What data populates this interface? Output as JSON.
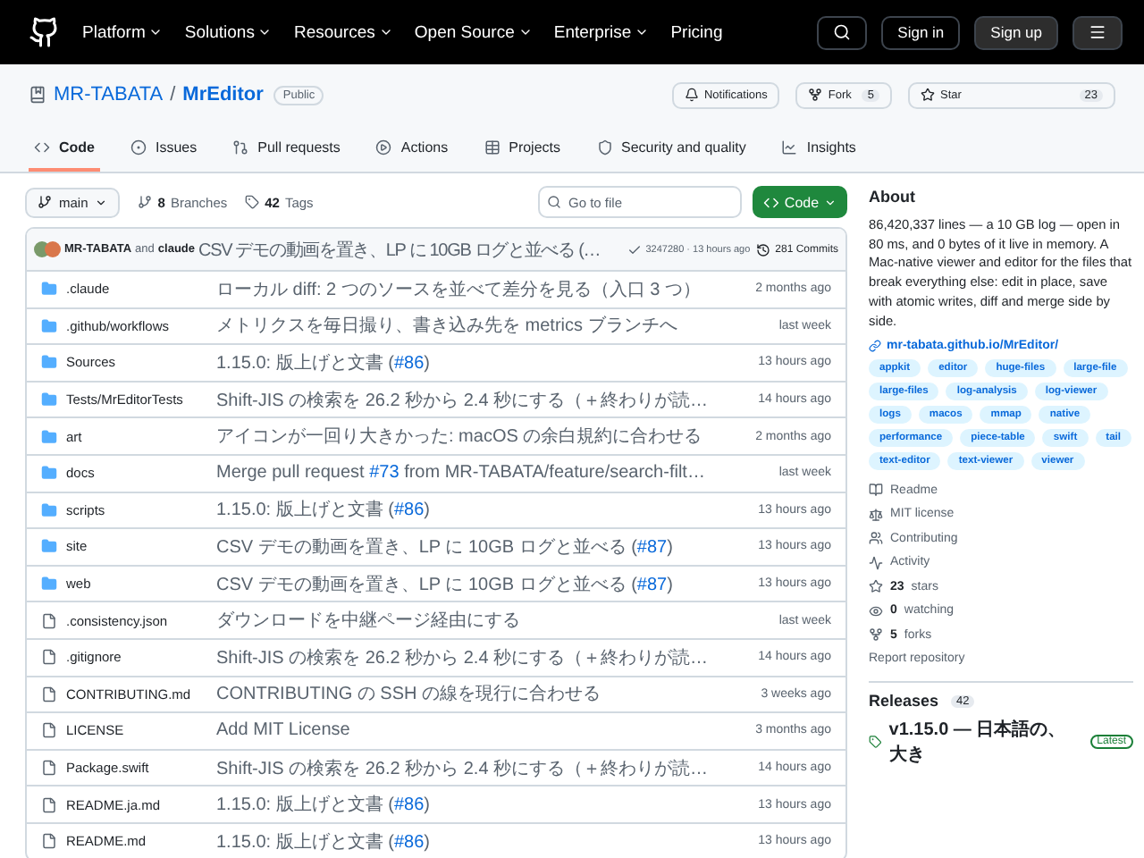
{
  "nav": {
    "items": [
      "Platform",
      "Solutions",
      "Resources",
      "Open Source",
      "Enterprise",
      "Pricing"
    ],
    "dropdown": [
      true,
      true,
      true,
      true,
      true,
      false
    ],
    "sign_in": "Sign in",
    "sign_up": "Sign up"
  },
  "repo": {
    "owner": "MR-TABATA",
    "separator": "/",
    "name": "MrEditor",
    "visibility": "Public",
    "notifications": "Notifications",
    "fork": "Fork",
    "fork_count": "5",
    "star": "Star",
    "star_count": "23"
  },
  "tabs": [
    {
      "label": "Code",
      "selected": true
    },
    {
      "label": "Issues",
      "selected": false
    },
    {
      "label": "Pull requests",
      "selected": false
    },
    {
      "label": "Actions",
      "selected": false
    },
    {
      "label": "Projects",
      "selected": false
    },
    {
      "label": "Security and quality",
      "selected": false
    },
    {
      "label": "Insights",
      "selected": false
    }
  ],
  "toolbar": {
    "branch": "main",
    "branches_count": "8",
    "branches": "Branches",
    "tags_count": "42",
    "tags": "Tags",
    "search_placeholder": "Go to file",
    "code_button": "Code"
  },
  "commit": {
    "author": "MR-TABATA",
    "and": "and",
    "coauthor": "claude",
    "message": "CSV デモの動画を置き、LP に 10GB ログと並べる (…",
    "hash": "3247280 · 13 hours ago",
    "commits": "281 Commits"
  },
  "files": [
    {
      "kind": "folder",
      "name": ".claude",
      "message": {
        "before": "ローカル diff: 2 つのソースを並べて差分を見る（入口 3 つ）"
      },
      "time": "2 months ago"
    },
    {
      "kind": "folder",
      "name": ".github/workflows",
      "message": {
        "before": "メトリクスを毎日撮り、書き込み先を metrics ブランチへ"
      },
      "time": "last week"
    },
    {
      "kind": "folder",
      "name": "Sources",
      "message": {
        "before": "1.15.0: 版上げと文書 (",
        "link": "#86",
        "after": ")"
      },
      "time": "13 hours ago"
    },
    {
      "kind": "folder",
      "name": "Tests/MrEditorTests",
      "message": {
        "before": "Shift-JIS の検索を 26.2 秒から 2.4 秒にする（＋終わりが読…"
      },
      "time": "14 hours ago"
    },
    {
      "kind": "folder",
      "name": "art",
      "message": {
        "before": "アイコンが一回り大きかった: macOS の余白規約に合わせる"
      },
      "time": "2 months ago"
    },
    {
      "kind": "folder",
      "name": "docs",
      "message": {
        "before": "Merge pull request ",
        "link": "#73",
        "after": " from MR-TABATA/feature/search-filt…"
      },
      "time": "last week"
    },
    {
      "kind": "folder",
      "name": "scripts",
      "message": {
        "before": "1.15.0: 版上げと文書 (",
        "link": "#86",
        "after": ")"
      },
      "time": "13 hours ago"
    },
    {
      "kind": "folder",
      "name": "site",
      "message": {
        "before": "CSV デモの動画を置き、LP に 10GB ログと並べる (",
        "link": "#87",
        "after": ")"
      },
      "time": "13 hours ago"
    },
    {
      "kind": "folder",
      "name": "web",
      "message": {
        "before": "CSV デモの動画を置き、LP に 10GB ログと並べる (",
        "link": "#87",
        "after": ")"
      },
      "time": "13 hours ago"
    },
    {
      "kind": "file",
      "name": ".consistency.json",
      "message": {
        "before": "ダウンロードを中継ページ経由にする"
      },
      "time": "last week"
    },
    {
      "kind": "file",
      "name": ".gitignore",
      "message": {
        "before": "Shift-JIS の検索を 26.2 秒から 2.4 秒にする（＋終わりが読…"
      },
      "time": "14 hours ago"
    },
    {
      "kind": "file",
      "name": "CONTRIBUTING.md",
      "message": {
        "before": "CONTRIBUTING の SSH の線を現行に合わせる"
      },
      "time": "3 weeks ago"
    },
    {
      "kind": "file",
      "name": "LICENSE",
      "message": {
        "before": "Add MIT License"
      },
      "time": "3 months ago"
    },
    {
      "kind": "file",
      "name": "Package.swift",
      "message": {
        "before": "Shift-JIS の検索を 26.2 秒から 2.4 秒にする（＋終わりが読…"
      },
      "time": "14 hours ago"
    },
    {
      "kind": "file",
      "name": "README.ja.md",
      "message": {
        "before": "1.15.0: 版上げと文書 (",
        "link": "#86",
        "after": ")"
      },
      "time": "13 hours ago"
    },
    {
      "kind": "file",
      "name": "README.md",
      "message": {
        "before": "1.15.0: 版上げと文書 (",
        "link": "#86",
        "after": ")"
      },
      "time": "13 hours ago"
    }
  ],
  "about": {
    "title": "About",
    "description": "86,420,337 lines — a 10 GB log — open in 80 ms, and 0 bytes of it live in memory. A Mac-native viewer and editor for the files that break everything else: edit in place, save with atomic writes, diff and merge side by side.",
    "website": "mr-tabata.github.io/MrEditor/",
    "topics": [
      "appkit",
      "editor",
      "huge-files",
      "large-file",
      "large-files",
      "log-analysis",
      "log-viewer",
      "logs",
      "macos",
      "mmap",
      "native",
      "performance",
      "piece-table",
      "swift",
      "tail",
      "text-editor",
      "text-viewer",
      "viewer"
    ],
    "links": [
      {
        "kind": "book",
        "label": "Readme"
      },
      {
        "kind": "law",
        "label": "MIT license"
      },
      {
        "kind": "people",
        "label": "Contributing"
      },
      {
        "kind": "pulse",
        "label": "Activity"
      },
      {
        "kind": "star",
        "count": "23",
        "label": "stars"
      },
      {
        "kind": "eye",
        "count": "0",
        "label": "watching"
      },
      {
        "kind": "fork",
        "count": "5",
        "label": "forks"
      }
    ],
    "report": "Report repository"
  },
  "releases": {
    "title": "Releases",
    "count": "42",
    "latest_name": "v1.15.0 — 日本語の、大き",
    "latest_badge": "Latest"
  }
}
